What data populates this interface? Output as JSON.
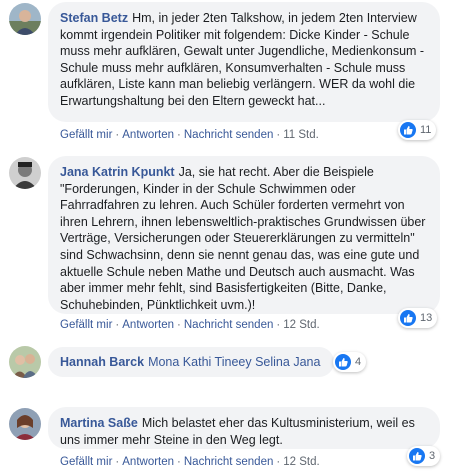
{
  "labels": {
    "like": "Gefällt mir",
    "reply": "Antworten",
    "message": "Nachricht senden",
    "dot": "·"
  },
  "colors": {
    "link": "#385898",
    "bubble": "#f2f3f5",
    "like_blue": "#1877f2",
    "meta": "#606770"
  },
  "comments": [
    {
      "author": "Stefan Betz",
      "text": "Hm, in jeder 2ten Talkshow, in jedem 2ten Interview kommt irgendein Politiker mit folgendem: Dicke Kinder - Schule muss mehr aufklären, Gewalt unter Jugendliche, Medienkonsum - Schule muss mehr aufklären, Konsumverhalten - Schule muss aufklären, Liste kann man beliebig verlängern. WER da wohl die Erwartungshaltung bei den Eltern geweckt hat...",
      "time": "11 Std.",
      "likes": "11",
      "avatar_icon": "person-photo"
    },
    {
      "author": "Jana Katrin Kpunkt",
      "text": "Ja, sie hat recht. Aber die Beispiele \"Forderungen, Kinder in der Schule Schwimmen oder Fahrradfahren zu lehren. Auch Schüler forderten vermehrt von ihren Lehrern, ihnen lebensweltlich-praktisches Grundwissen über Verträge, Versicherungen oder Steuererklärungen zu vermitteln\" sind Schwachsinn, denn sie nennt genau das, was eine gute und aktuelle Schule neben Mathe und Deutsch auch ausmacht. Was aber immer mehr fehlt, sind Basisfertigkeiten (Bitte, Danke, Schuhebinden, Pünktlichkeit uvm.)!",
      "time": "12 Std.",
      "likes": "13",
      "avatar_icon": "person-photo"
    },
    {
      "author": "Hannah Barck",
      "tags": [
        "Mona Kathi Tineey",
        "Selina Jana"
      ],
      "likes": "4",
      "avatar_icon": "group-photo"
    },
    {
      "author": "Martina Saße",
      "text": "Mich belastet eher das Kultusministerium, weil es uns immer mehr Steine in den Weg legt.",
      "time": "12 Std.",
      "likes": "3",
      "avatar_icon": "person-photo"
    }
  ]
}
